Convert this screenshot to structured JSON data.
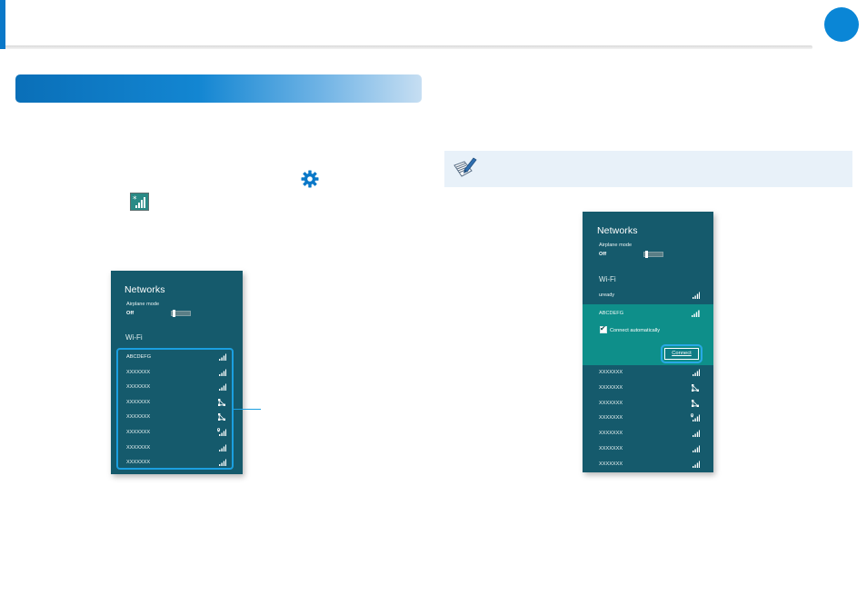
{
  "left_panel": {
    "title": "Networks",
    "airplane_label": "Airplane mode",
    "airplane_value": "Off",
    "wifi_heading": "Wi-Fi",
    "networks": [
      {
        "name": "ABCDEFG",
        "icon": "signal-icon"
      },
      {
        "name": "XXXXXXX",
        "icon": "signal-icon"
      },
      {
        "name": "XXXXXXX",
        "icon": "signal-icon"
      },
      {
        "name": "XXXXXXX",
        "icon": "ad-hoc-network-icon"
      },
      {
        "name": "XXXXXXX",
        "icon": "ad-hoc-network-icon"
      },
      {
        "name": "XXXXXXX",
        "icon": "secured-signal-icon"
      },
      {
        "name": "XXXXXXX",
        "icon": "signal-icon"
      },
      {
        "name": "XXXXXXX",
        "icon": "signal-icon"
      }
    ]
  },
  "right_panel": {
    "title": "Networks",
    "airplane_label": "Airplane mode",
    "airplane_value": "Off",
    "wifi_heading": "Wi-Fi",
    "top_networks": [
      {
        "name": "uready",
        "icon": "signal-icon"
      }
    ],
    "selected_network": {
      "name": "ABCDEFG",
      "icon": "signal-icon"
    },
    "connect_auto_label": "Connect automatically",
    "connect_auto_checked": true,
    "connect_button": "Connect",
    "networks": [
      {
        "name": "XXXXXXX",
        "icon": "signal-icon"
      },
      {
        "name": "XXXXXXX",
        "icon": "ad-hoc-network-icon"
      },
      {
        "name": "XXXXXXX",
        "icon": "ad-hoc-network-icon"
      },
      {
        "name": "XXXXXXX",
        "icon": "secured-signal-icon"
      },
      {
        "name": "XXXXXXX",
        "icon": "signal-icon"
      },
      {
        "name": "XXXXXXX",
        "icon": "signal-icon"
      },
      {
        "name": "XXXXXXX",
        "icon": "signal-icon"
      }
    ]
  },
  "icons": {
    "settings": "gear-icon",
    "network": "network-icon",
    "note": "note-pencil-icon"
  },
  "colors": {
    "accent": "#0a86d6",
    "panel_bg": "#155a6c",
    "selected_bg": "#0e8f8a",
    "highlight": "#1b9fe0"
  }
}
